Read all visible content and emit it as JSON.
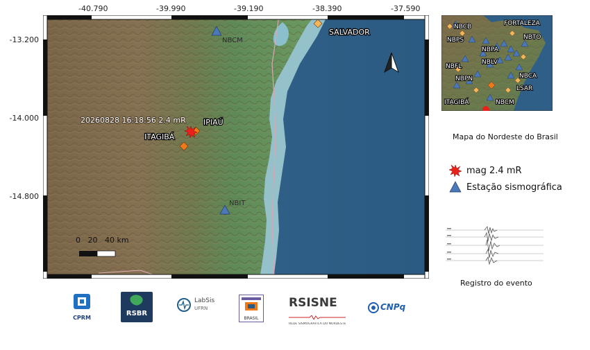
{
  "axes": {
    "top_ticks": [
      "-40.790",
      "-39.990",
      "-39.190",
      "-38.390",
      "-37.590"
    ],
    "left_ticks": [
      "-13.200",
      "-14.000",
      "-14.800"
    ]
  },
  "map": {
    "event_label": "20260828 16:18:56 2.4 mR",
    "places": {
      "ipiau": "IPIAÚ",
      "itagiba": "ITAGIBÁ",
      "salvador": "SALVADOR"
    },
    "stations": {
      "nbcm": "NBCM",
      "nbit": "NBIT"
    },
    "scale_bar": "0   20   40 km"
  },
  "inset": {
    "labels": {
      "fortaleza": "FORTALEZA",
      "nbcb": "NBCB",
      "nbps": "NBPS",
      "nbpa": "NBPA",
      "nbfl": "NBFL",
      "nblv": "NBLV",
      "nbpn": "NBPN",
      "nbca": "NBCA",
      "lsar": "LSAR",
      "nbto": "NBTO",
      "itagiba": "ITAGIBÁ",
      "nbcm": "NBCM"
    },
    "caption": "Mapa do Nordeste do Brasil"
  },
  "legend": {
    "event": "mag 2.4 mR",
    "station": "Estação sismográfica"
  },
  "seismogram": {
    "caption": "Registro do evento"
  },
  "logos": {
    "cprm": "CPRM",
    "rsbr": "RSBR",
    "labsis": "LabSis",
    "labsis_sub": "UFRN",
    "brasil": "BRASIL",
    "rsisne": "RSISNE",
    "rsisne_sub": "REDE SISMOGRÁFICA DO NORDESTE DO BRASIL",
    "cnpq": "CNPq"
  },
  "colors": {
    "event": "#e8211b",
    "station": "#4a78b8",
    "city": "#f07a1a"
  }
}
